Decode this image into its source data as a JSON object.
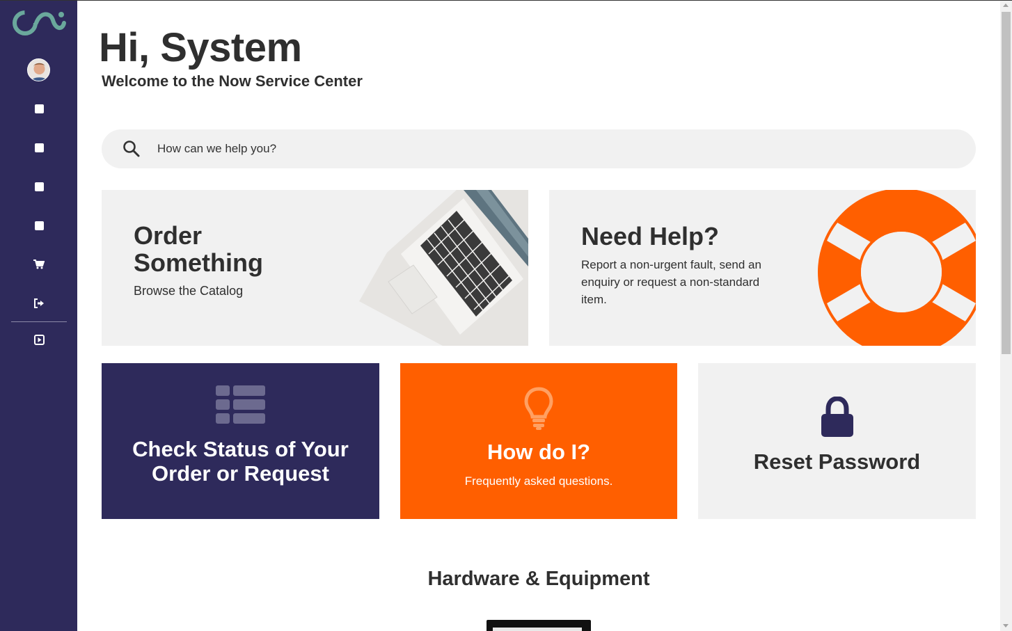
{
  "header": {
    "greeting": "Hi, System",
    "welcome": "Welcome to the Now Service Center"
  },
  "search": {
    "placeholder": "How can we help you?",
    "icon": "search-icon"
  },
  "sidebar": {
    "logo": "service-center-logo",
    "avatar": "user-avatar",
    "items": [
      {
        "icon": "square-icon"
      },
      {
        "icon": "square-icon"
      },
      {
        "icon": "square-icon"
      },
      {
        "icon": "square-icon"
      },
      {
        "icon": "cart-icon"
      },
      {
        "icon": "sign-out-icon"
      },
      {
        "icon": "play-square-icon"
      }
    ]
  },
  "cards": {
    "order": {
      "title": "Order Something",
      "subtitle": "Browse the Catalog"
    },
    "help": {
      "title": "Need Help?",
      "description": "Report a non-urgent fault, send an enquiry or request a non-standard item."
    },
    "status": {
      "title": "Check Status of Your Order or Request"
    },
    "howdo": {
      "title": "How do I?",
      "subtitle": "Frequently asked questions."
    },
    "reset": {
      "title": "Reset Password"
    }
  },
  "sections": {
    "hardware_title": "Hardware & Equipment"
  },
  "colors": {
    "sidebar": "#2e2a5b",
    "accent_orange": "#ff5f00",
    "card_gray": "#f1f1f1",
    "text_dark": "#2f2f2f",
    "logo_teal": "#6aa89c"
  }
}
